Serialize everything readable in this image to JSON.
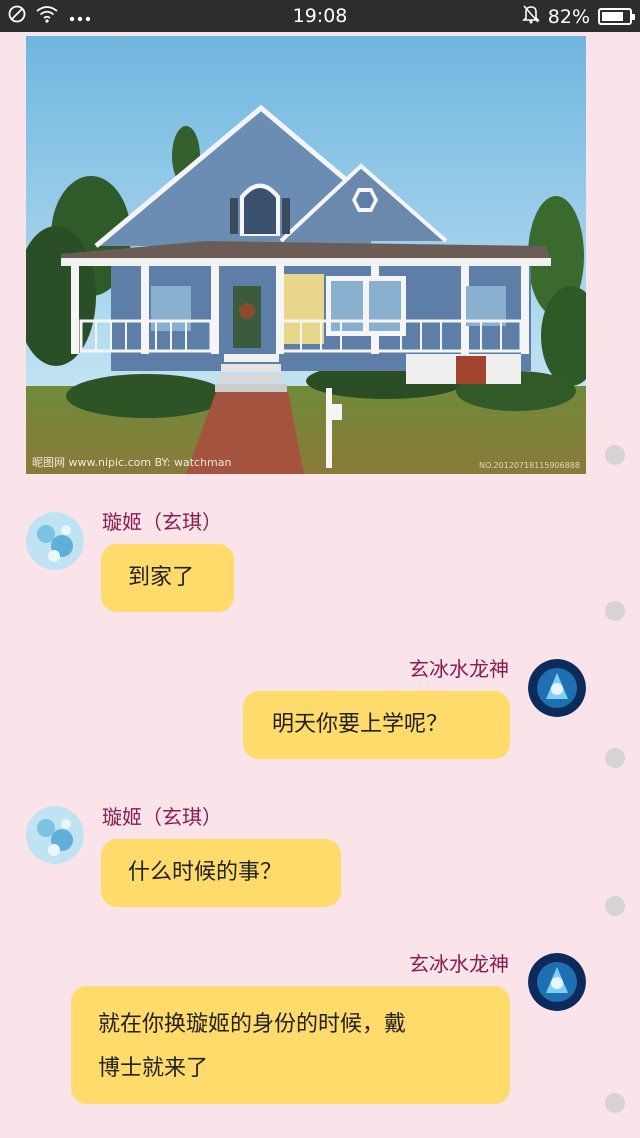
{
  "status_bar": {
    "time": "19:08",
    "battery": "82%",
    "battery_level": 0.82,
    "icons": [
      "blocked-circle-icon",
      "wifi-icon",
      "more-dots-icon",
      "mute-bell-icon",
      "battery-icon"
    ]
  },
  "photo": {
    "description_icon": "house-photo",
    "watermark_left": "昵图网 www.nipic.com  BY: watchman",
    "watermark_right": "NO.20120718115906888"
  },
  "messages": [
    {
      "sender": "璇姬（玄琪）",
      "text": "到家了",
      "side": "left",
      "avatar": "friend-avatar"
    },
    {
      "sender": "玄冰水龙神",
      "text": "明天你要上学呢？",
      "side": "right",
      "avatar": "self-avatar"
    },
    {
      "sender": "璇姬（玄琪）",
      "text": "什么时候的事？",
      "side": "left",
      "avatar": "friend-avatar"
    },
    {
      "sender": "玄冰水龙神",
      "text_line1": "就在你换璇姬的身份的时候，戴",
      "text_line2": "博士就来了",
      "side": "right",
      "avatar": "self-avatar"
    }
  ],
  "colors": {
    "background": "#fae4ea",
    "bubble": "#fedb6a",
    "name": "#8a1c50",
    "status_bar": "#2d2d2d"
  }
}
